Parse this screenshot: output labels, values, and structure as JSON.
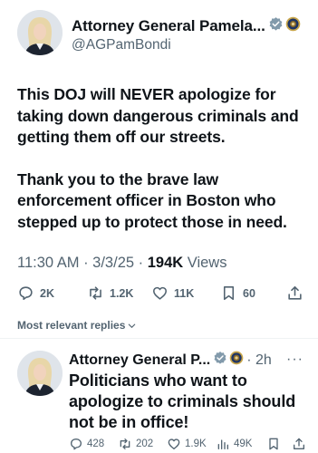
{
  "tweet": {
    "author_name": "Attorney General Pamela...",
    "handle": "@AGPamBondi",
    "text_paragraphs": [
      "This DOJ will NEVER apologize for taking down dangerous criminals and getting them off our streets.",
      "Thank you to the brave law enforcement officer in Boston who stepped up to protect those in need."
    ],
    "time": "11:30 AM",
    "sep1": " · ",
    "date": "3/3/25",
    "sep2": " · ",
    "views_count": "194K",
    "views_label": " Views",
    "actions": {
      "replies": "2K",
      "reposts": "1.2K",
      "likes": "11K",
      "bookmarks": "60"
    }
  },
  "replies_filter": {
    "label": "Most relevant replies"
  },
  "reply": {
    "author_name": "Attorney General P...",
    "time_ago": "· 2h",
    "more_label": "···",
    "text": "Politicians who want to apologize to criminals should not be in office!",
    "actions": {
      "replies": "428",
      "reposts": "202",
      "likes": "1.9K",
      "views": "49K"
    }
  },
  "colors": {
    "text": "#0f1419",
    "secondary": "#536471",
    "badge_gray": "#829aab",
    "divider": "#eff3f4",
    "seal_gold": "#c9a64a"
  },
  "icons": [
    "reply-icon",
    "repost-icon",
    "like-icon",
    "bookmark-icon",
    "share-icon",
    "views-icon",
    "verified-badge-icon",
    "doj-seal-icon",
    "chevron-down-icon",
    "more-icon"
  ]
}
